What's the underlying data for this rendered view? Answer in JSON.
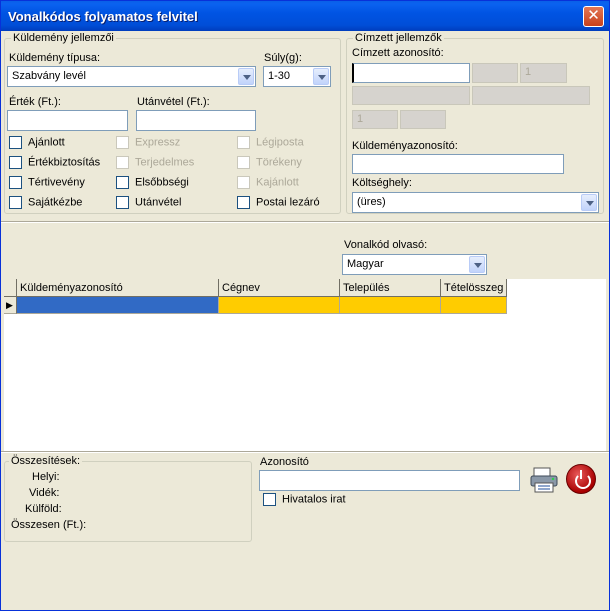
{
  "window": {
    "title": "Vonalkódos folyamatos felvitel",
    "close_glyph": "✕"
  },
  "kuldemeny": {
    "group_title": "Küldemény jellemzői",
    "tipus_label": "Küldemény típusa:",
    "tipus_value": "Szabvány levél",
    "suly_label": "Súly(g):",
    "suly_value": "1-30",
    "ertek_label": "Érték (Ft.):",
    "ertek_value": "",
    "utanvetel_label": "Utánvétel (Ft.):",
    "utanvetel_value": "",
    "checkboxes": [
      {
        "label": "Ajánlott",
        "checked": false,
        "disabled": false
      },
      {
        "label": "Expressz",
        "checked": false,
        "disabled": true
      },
      {
        "label": "Légiposta",
        "checked": false,
        "disabled": true
      },
      {
        "label": "Értékbiztosítás",
        "checked": false,
        "disabled": false
      },
      {
        "label": "Terjedelmes",
        "checked": false,
        "disabled": true
      },
      {
        "label": "Törékeny",
        "checked": false,
        "disabled": true
      },
      {
        "label": "Tértivevény",
        "checked": false,
        "disabled": false
      },
      {
        "label": "Elsőbbségi",
        "checked": false,
        "disabled": false
      },
      {
        "label": "Kajánlott",
        "checked": false,
        "disabled": true
      },
      {
        "label": "Sajátkézbe",
        "checked": false,
        "disabled": false
      },
      {
        "label": "Utánvétel",
        "checked": false,
        "disabled": false
      },
      {
        "label": "Postai lezáró",
        "checked": false,
        "disabled": false
      }
    ]
  },
  "cimzett": {
    "group_title": "Címzett jellemzők",
    "azonosito_label": "Címzett azonosító:",
    "azonosito_value": "",
    "field_a": "1",
    "field_b": "1",
    "kuldemenyazonosito_label": "Küldeményazonosító:",
    "kuldemenyazonosito_value": "",
    "koltseghely_label": "Költséghely:",
    "koltseghely_value": "(üres)"
  },
  "vonalkod": {
    "label": "Vonalkód olvasó:",
    "value": "Magyar"
  },
  "grid": {
    "columns": [
      "Küldeményazonosító",
      "Cégnev",
      "Település",
      "Tételösszeg"
    ],
    "row_indicator": "▶",
    "selected_color": "#316AC5",
    "highlight_color": "#FFCC00"
  },
  "summary": {
    "group_title": "Összesítések:",
    "helyi_label": "Helyi:",
    "videk_label": "Vidék:",
    "kulfold_label": "Külföld:",
    "osszesen_label": "Összesen (Ft.):"
  },
  "bottom": {
    "azonosito_label": "Azonosító",
    "azonosito_value": "",
    "hivatalos_label": "Hivatalos irat",
    "print_icon": "printer-icon",
    "exit_icon": "power-icon"
  }
}
